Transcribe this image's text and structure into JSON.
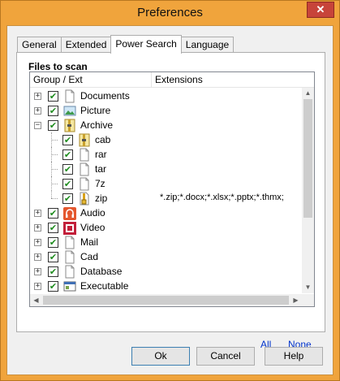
{
  "window": {
    "title": "Preferences",
    "close_glyph": "✕"
  },
  "tabs": [
    {
      "label": "General"
    },
    {
      "label": "Extended"
    },
    {
      "label": "Power Search"
    },
    {
      "label": "Language"
    }
  ],
  "active_tab": "Power Search",
  "section": {
    "label": "Files to scan"
  },
  "tree": {
    "columns": [
      "Group / Ext",
      "Extensions"
    ],
    "rows": [
      {
        "label": "Documents",
        "checked": true,
        "icon": "document-icon"
      },
      {
        "label": "Picture",
        "checked": true,
        "icon": "picture-icon"
      },
      {
        "label": "Archive",
        "checked": true,
        "icon": "archive-icon"
      },
      {
        "label": "cab",
        "checked": true,
        "icon": "cab-archive-icon"
      },
      {
        "label": "rar",
        "checked": true,
        "icon": "blank-file-icon"
      },
      {
        "label": "tar",
        "checked": true,
        "icon": "blank-file-icon"
      },
      {
        "label": "7z",
        "checked": true,
        "icon": "blank-file-icon"
      },
      {
        "label": "zip",
        "checked": true,
        "icon": "zip-archive-icon",
        "extensions": "*.zip;*.docx;*.xlsx;*.pptx;*.thmx;"
      },
      {
        "label": "Audio",
        "checked": true,
        "icon": "headphones-icon"
      },
      {
        "label": "Video",
        "checked": true,
        "icon": "video-icon"
      },
      {
        "label": "Mail",
        "checked": true,
        "icon": "document-icon"
      },
      {
        "label": "Cad",
        "checked": true,
        "icon": "document-icon"
      },
      {
        "label": "Database",
        "checked": true,
        "icon": "document-icon"
      },
      {
        "label": "Executable",
        "checked": true,
        "icon": "executable-icon"
      }
    ],
    "expander_plus": "+",
    "expander_minus": "−",
    "check_glyph": "✔"
  },
  "links": {
    "all": "All",
    "none": "None"
  },
  "buttons": {
    "ok": "Ok",
    "cancel": "Cancel",
    "help": "Help"
  },
  "colors": {
    "title_bar": "#f0a43c",
    "check": "#1e8c1e",
    "link": "#0033cc"
  }
}
